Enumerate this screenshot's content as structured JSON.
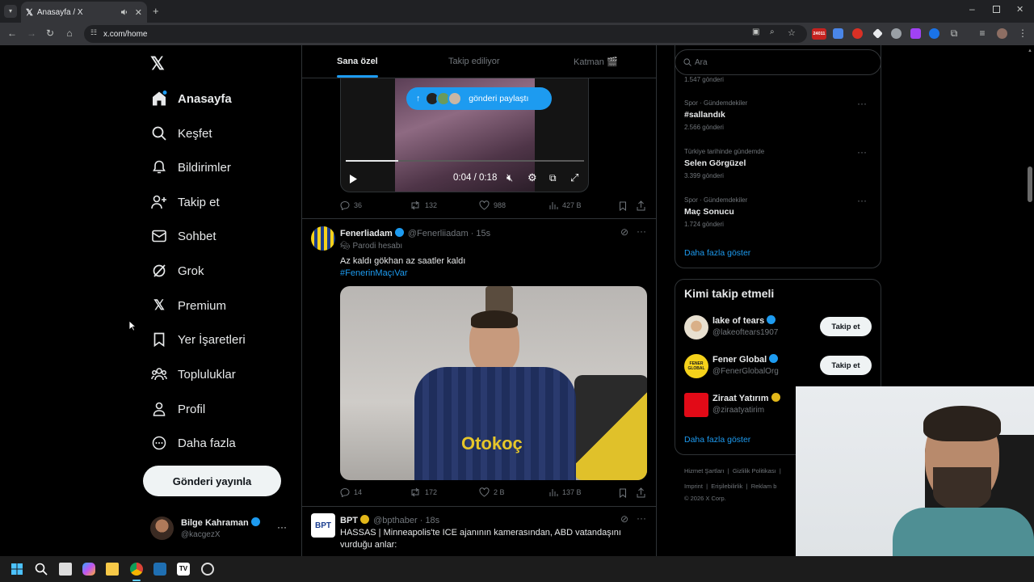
{
  "browser": {
    "tab_title": "Anasayfa / X",
    "url": "x.com/home",
    "ext_badge": "24011"
  },
  "nav": {
    "items": [
      {
        "label": "Anasayfa",
        "icon": "home-icon"
      },
      {
        "label": "Keşfet",
        "icon": "search-icon"
      },
      {
        "label": "Bildirimler",
        "icon": "bell-icon"
      },
      {
        "label": "Takip et",
        "icon": "person-add-icon"
      },
      {
        "label": "Sohbet",
        "icon": "mail-icon"
      },
      {
        "label": "Grok",
        "icon": "grok-icon"
      },
      {
        "label": "Premium",
        "icon": "x-logo-icon"
      },
      {
        "label": "Yer İşaretleri",
        "icon": "bookmark-icon"
      },
      {
        "label": "Topluluklar",
        "icon": "people-icon"
      },
      {
        "label": "Profil",
        "icon": "person-icon"
      },
      {
        "label": "Daha fazla",
        "icon": "more-circle-icon"
      }
    ],
    "post_button": "Gönderi yayınla",
    "account": {
      "name": "Bilge Kahraman",
      "handle": "@kacgezX"
    }
  },
  "feed": {
    "tabs": [
      "Sana özel",
      "Takip ediliyor",
      "Katman 🎬"
    ],
    "share_pill": "gönderi paylaştı",
    "post1": {
      "video_time": "0:04 / 0:18",
      "video_progress": 0.22,
      "stats": {
        "replies": "36",
        "reposts": "132",
        "likes": "988",
        "views": "427 B"
      }
    },
    "post2": {
      "name": "Fenerliadam",
      "handle": "@Fenerliiadam",
      "time": "· 15s",
      "label": "Parodi hesabı",
      "text": "Az kaldı gökhan az saatler kaldı",
      "hashtag": "#FenerinMaçıVar",
      "shirt_text": "Otokoç",
      "stats": {
        "replies": "14",
        "reposts": "172",
        "likes": "2 B",
        "views": "137 B"
      }
    },
    "post3": {
      "name": "BPT",
      "handle": "@bpthaber",
      "time": "· 18s",
      "avatar_text": "BPT",
      "text": "HASSAS | Minneapolis'te ICE ajanının kamerasından, ABD vatandaşını vurduğu anlar:"
    }
  },
  "right": {
    "search_placeholder": "Ara",
    "top_count": "1.547 gönderi",
    "trends": [
      {
        "context": "Spor · Gündemdekiler",
        "name": "#sallandık",
        "count": "2.566 gönderi"
      },
      {
        "context": "Türkiye tarihinde gündemde",
        "name": "Selen Görgüzel",
        "count": "3.399 gönderi"
      },
      {
        "context": "Spor · Gündemdekiler",
        "name": "Maç Sonucu",
        "count": "1.724 gönderi"
      }
    ],
    "show_more": "Daha fazla göster",
    "who_title": "Kimi takip etmeli",
    "who": [
      {
        "name": "lake of tears",
        "handle": "@lakeoftears1907",
        "button": "Takip et"
      },
      {
        "name": "Fener Global",
        "handle": "@FenerGlobalOrg",
        "button": "Takip et",
        "avatar_text": "FENER GLOBAL"
      },
      {
        "name": "Ziraat Yatırım",
        "handle": "@ziraatyatirim"
      }
    ],
    "show_more2": "Daha fazla göster",
    "footer": {
      "line1": [
        "Hizmet Şartları",
        "|",
        "Gizlilik Politikası",
        "|"
      ],
      "line2": [
        "Imprint",
        "|",
        "Erişilebilirlik",
        "|",
        "Reklam b"
      ],
      "copyright": "© 2026 X Corp."
    }
  },
  "colors": {
    "accent": "#1d9bf0",
    "bg": "#000000",
    "border": "#2f3336",
    "muted": "#71767b"
  }
}
